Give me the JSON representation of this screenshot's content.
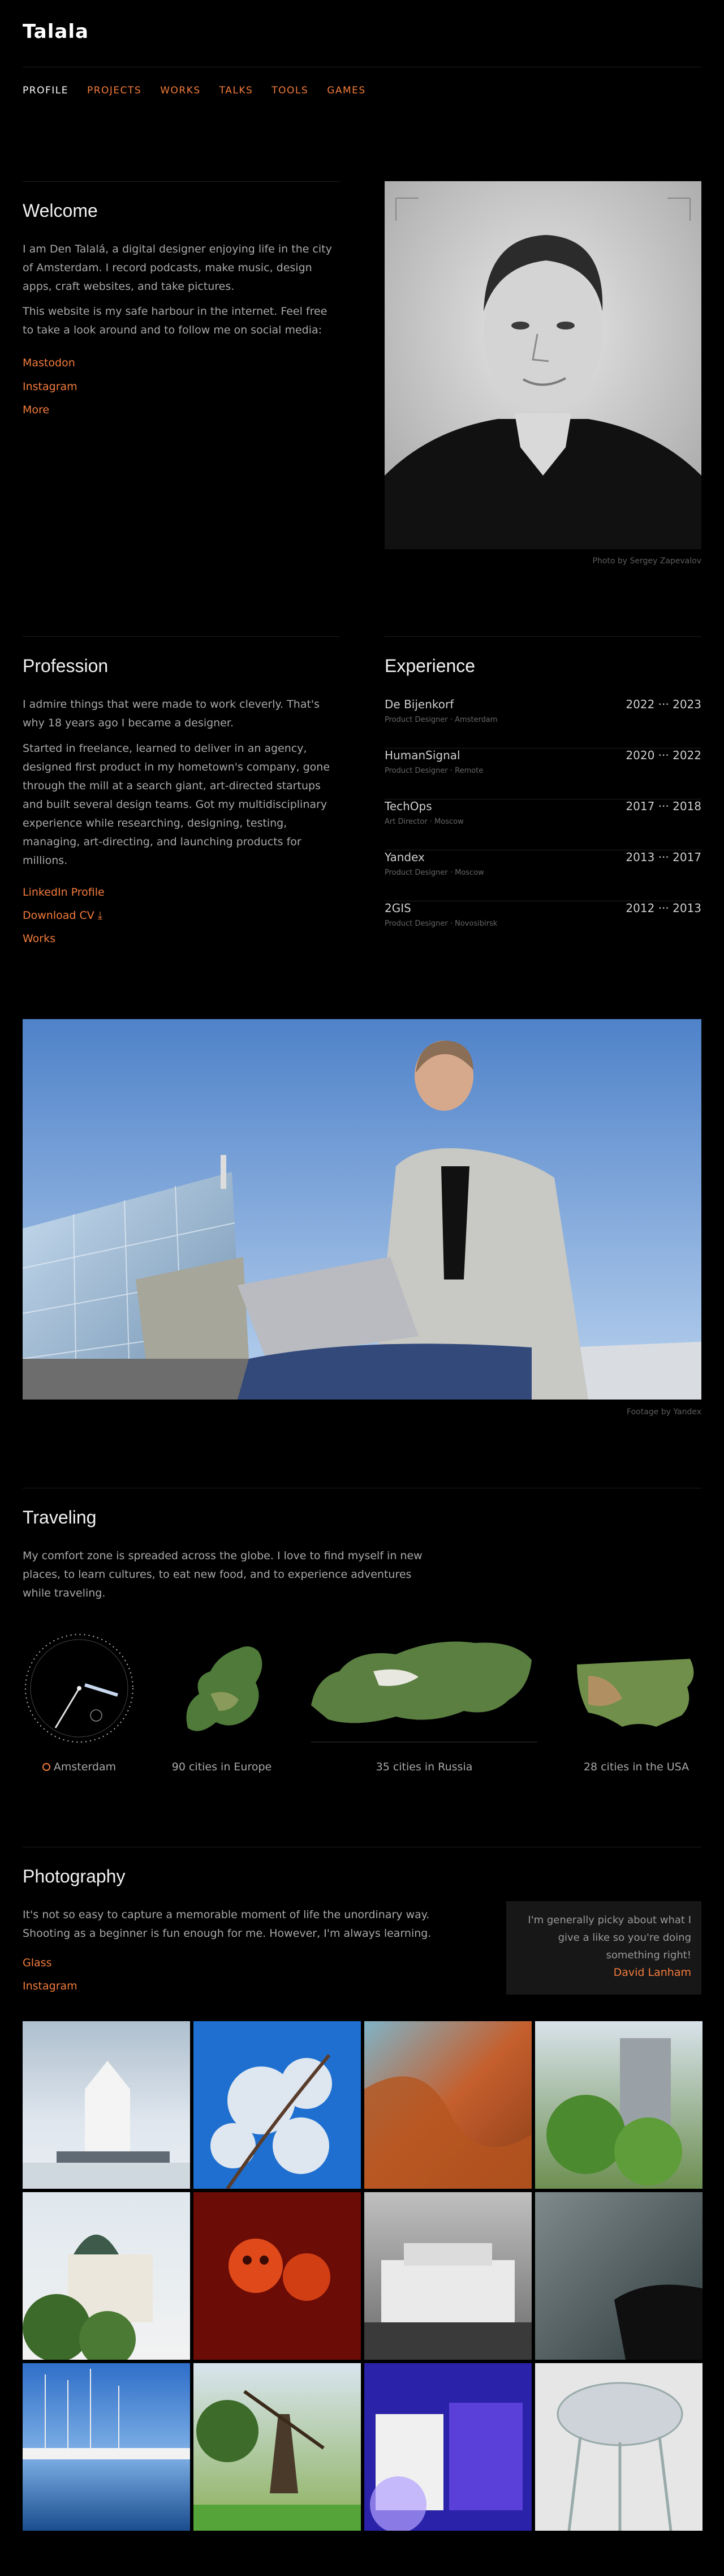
{
  "logo": "Talala",
  "nav": [
    {
      "label": "PROFILE"
    },
    {
      "label": "PROJECTS"
    },
    {
      "label": "WORKS"
    },
    {
      "label": "TALKS"
    },
    {
      "label": "TOOLS"
    },
    {
      "label": "GAMES"
    }
  ],
  "welcome": {
    "title": "Welcome",
    "p1": "I am Den Talalá, a digital designer enjoying life in the city of Amsterdam. I record podcasts, make music, design apps, craft websites, and take pictures.",
    "p2": "This website is my safe harbour in the internet. Feel free to take a look around and to follow me on social media:",
    "links": [
      "Mastodon",
      "Instagram",
      "More"
    ],
    "photo_credit": "Photo by Sergey Zapevalov"
  },
  "profession": {
    "title": "Profession",
    "p1": "I admire things that were made to work cleverly. That's why 18 years ago I became a designer.",
    "p2": "Started in freelance, learned to deliver in an agency, designed first product in my hometown's company, gone through the mill at a search giant, art-directed startups and built several design teams. Got my multidisciplinary experience while researching, designing, testing, managing, art-directing, and launching products for millions.",
    "links": [
      "LinkedIn Profile",
      "Download CV ⤓",
      "Works"
    ]
  },
  "experience": {
    "title": "Experience",
    "items": [
      {
        "company": "De Bijenkorf",
        "years": "2022 ··· 2023",
        "role": "Product Designer · Amsterdam"
      },
      {
        "company": "HumanSignal",
        "years": "2020 ··· 2022",
        "role": "Product Designer · Remote"
      },
      {
        "company": "TechOps",
        "years": "2017 ··· 2018",
        "role": "Art Director · Moscow"
      },
      {
        "company": "Yandex",
        "years": "2013 ··· 2017",
        "role": "Product Designer · Moscow"
      },
      {
        "company": "2GIS",
        "years": "2012 ··· 2013",
        "role": "Product Designer · Novosibirsk"
      }
    ]
  },
  "wide_photo_credit": "Footage by Yandex",
  "traveling": {
    "title": "Traveling",
    "p": "My comfort zone is spreaded across the globe. I love to find myself in new places, to learn cultures, to eat new food, and to experience adventures while traveling.",
    "labels": [
      "Amsterdam",
      "90 cities in Europe",
      "35 cities in Russia",
      "28 cities in the USA"
    ]
  },
  "photography": {
    "title": "Photography",
    "p": "It's not so easy to capture a memorable moment of life the unordinary way. Shooting as a beginner is fun enough for me. However, I'm always learning.",
    "links": [
      "Glass",
      "Instagram"
    ],
    "quote": "I'm generally picky about what I give a like so you're doing something right!",
    "quote_author": "David Lanham"
  },
  "colors": {
    "accent": "#f47c3c",
    "background": "#000000"
  }
}
